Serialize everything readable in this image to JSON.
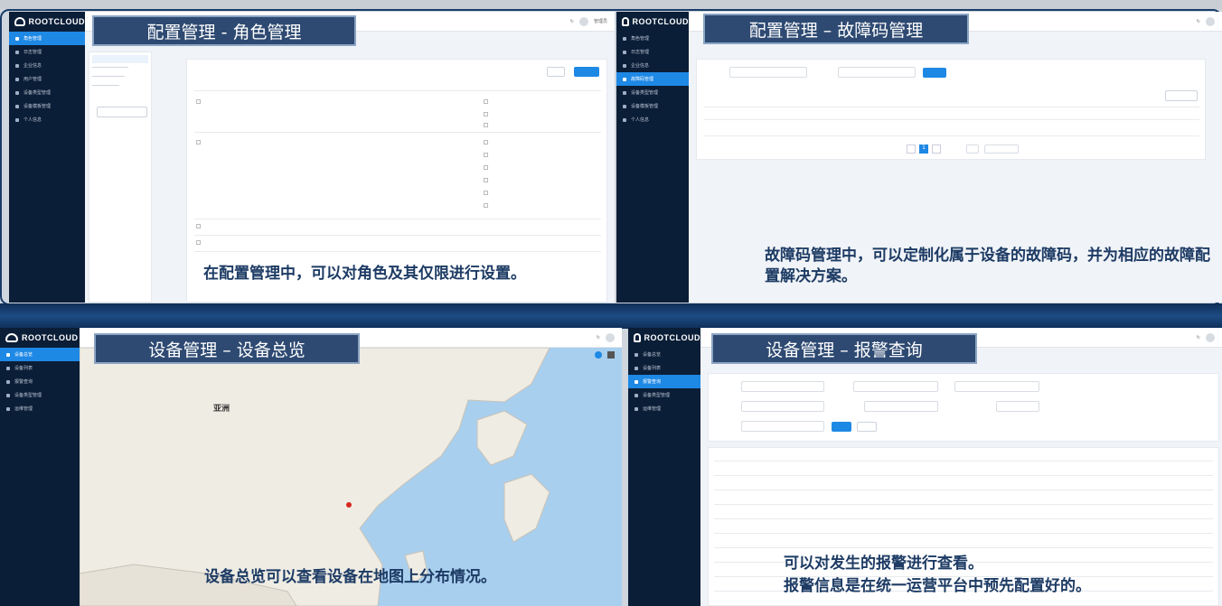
{
  "brand": "ROOTCLOUD",
  "panels": {
    "role": {
      "title": "配置管理 - 角色管理",
      "caption": "在配置管理中，可以对角色及其仅限进行设置。",
      "nav": [
        "角色管理",
        "日志管理",
        "企业信息",
        "用户管理",
        "设备类型管理",
        "设备模板管理",
        "个人信息"
      ],
      "user": "管理员"
    },
    "fault": {
      "title": "配置管理 – 故障码管理",
      "caption": "故障码管理中，可以定制化属于设备的故障码，并为相应的故障配置解决方案。",
      "nav": [
        "角色管理",
        "日志管理",
        "企业信息",
        "故障码管理",
        "设备类型管理",
        "设备模板管理",
        "个人信息"
      ],
      "pager_page": "1"
    },
    "overview": {
      "title": "设备管理 – 设备总览",
      "caption": "设备总览可以查看设备在地图上分布情况。",
      "map_label": "亚洲",
      "nav": [
        "设备总览",
        "设备列表",
        "报警查询",
        "设备类型管理",
        "运维管理"
      ]
    },
    "alarm": {
      "title": "设备管理 – 报警查询",
      "caption_line1": "可以对发生的报警进行查看。",
      "caption_line2": "报警信息是在统一运营平台中预先配置好的。",
      "nav": [
        "设备总览",
        "设备列表",
        "报警查询",
        "设备类型管理",
        "运维管理"
      ],
      "rows": 10
    }
  },
  "colors": {
    "sidebar": "#0b1e37",
    "accent": "#1e88e5",
    "title_box": "#2e4a72",
    "caption": "#1d3b64"
  }
}
